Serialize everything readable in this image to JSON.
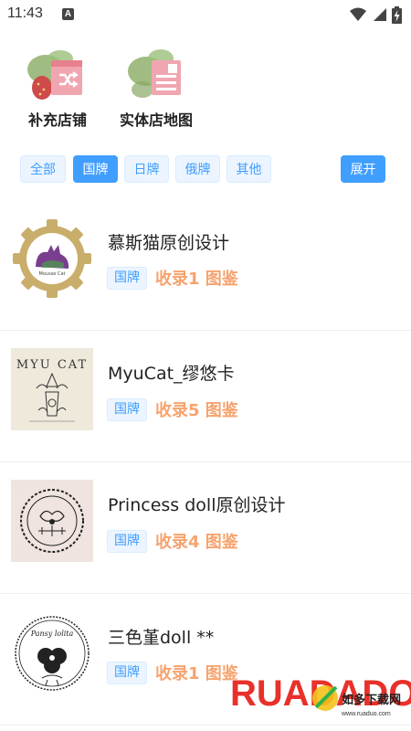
{
  "status_bar": {
    "time": "11:43",
    "a_badge": "A",
    "icons": [
      "wifi-icon",
      "signal-icon",
      "battery-charging-icon"
    ]
  },
  "shortcuts": [
    {
      "label": "补充店铺",
      "icon": "shop-add-icon"
    },
    {
      "label": "实体店地图",
      "icon": "store-map-icon"
    }
  ],
  "filters": {
    "chips": [
      {
        "label": "全部",
        "active": false
      },
      {
        "label": "国牌",
        "active": true
      },
      {
        "label": "日牌",
        "active": false
      },
      {
        "label": "俄牌",
        "active": false
      },
      {
        "label": "其他",
        "active": false
      }
    ],
    "expand_label": "展开"
  },
  "shops": [
    {
      "name": "慕斯猫原创设计",
      "tag": "国牌",
      "count_text": "收录1 图鉴",
      "logo": "mousse-cat-logo",
      "logo_text": "Mousse Cat"
    },
    {
      "name": "MyuCat_缪悠卡",
      "tag": "国牌",
      "count_text": "收录5 图鉴",
      "logo": "myucat-logo",
      "logo_text": "MYU CAT"
    },
    {
      "name": "Princess doll原创设计",
      "tag": "国牌",
      "count_text": "收录4 图鉴",
      "logo": "princess-doll-logo",
      "logo_text": ""
    },
    {
      "name": "三色堇doll **",
      "tag": "国牌",
      "count_text": "收录1 图鉴",
      "logo": "pansy-lolita-logo",
      "logo_text": "Pansy lolita"
    }
  ],
  "watermark": {
    "brand": "RUADADO",
    "sub": "如多下载网",
    "url": "www.ruaduo.com"
  },
  "colors": {
    "accent": "#409eff",
    "accent_light": "#ecf5ff",
    "count_orange": "#f6a36e",
    "watermark_red": "#e8312a",
    "watermark_green": "#2fb24a"
  }
}
